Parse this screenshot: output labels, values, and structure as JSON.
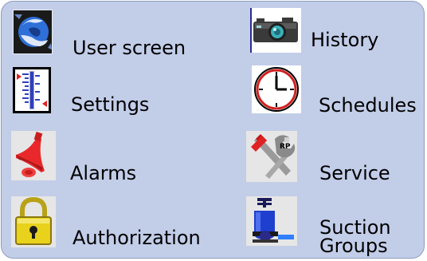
{
  "menu": {
    "items": [
      {
        "id": "user-screen",
        "label": "User screen",
        "icon": "globe-icon"
      },
      {
        "id": "history",
        "label": "History",
        "icon": "camera-icon"
      },
      {
        "id": "settings",
        "label": "Settings",
        "icon": "thermometer-scale-icon"
      },
      {
        "id": "schedules",
        "label": "Schedules",
        "icon": "clock-icon"
      },
      {
        "id": "alarms",
        "label": "Alarms",
        "icon": "bell-icon"
      },
      {
        "id": "service",
        "label": "Service",
        "icon": "tools-icon"
      },
      {
        "id": "authorization",
        "label": "Authorization",
        "icon": "padlock-icon"
      },
      {
        "id": "suction-groups",
        "label_line1": "Suction",
        "label_line2": "Groups",
        "icon": "compressor-icon"
      }
    ]
  },
  "colors": {
    "panel_bg": "#c2cde8",
    "panel_border": "#8f9dc2"
  }
}
